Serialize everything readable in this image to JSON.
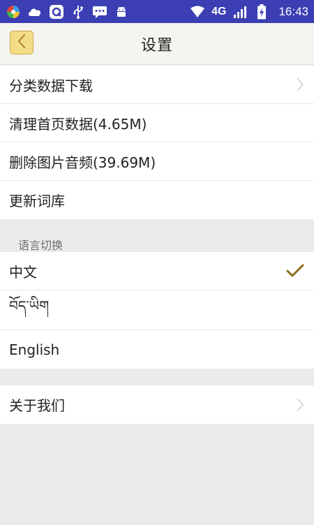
{
  "status_bar": {
    "time": "16:43",
    "network": "4G",
    "icons": [
      "color-wheel-icon",
      "cloud-icon",
      "q-app-icon",
      "usb-icon",
      "message-icon",
      "android-icon",
      "wifi-icon",
      "signal-icon",
      "battery-icon"
    ],
    "background_color": "#3b3fb3"
  },
  "header": {
    "title": "设置",
    "back_icon": "chevron-left-icon",
    "accent_color": "#f3dc86"
  },
  "settings": {
    "items": [
      {
        "label": "分类数据下载",
        "has_chevron": true
      },
      {
        "label": "清理首页数据(4.65M)"
      },
      {
        "label": "删除图片音频(39.69M)"
      },
      {
        "label": "更新词库"
      }
    ]
  },
  "language": {
    "section_label": "语言切换",
    "options": [
      {
        "label": "中文",
        "selected": true
      },
      {
        "label": "བོད་ཡིག"
      },
      {
        "label": "English"
      }
    ],
    "check_color": "#8a6d1f"
  },
  "about": {
    "label": "关于我们"
  }
}
